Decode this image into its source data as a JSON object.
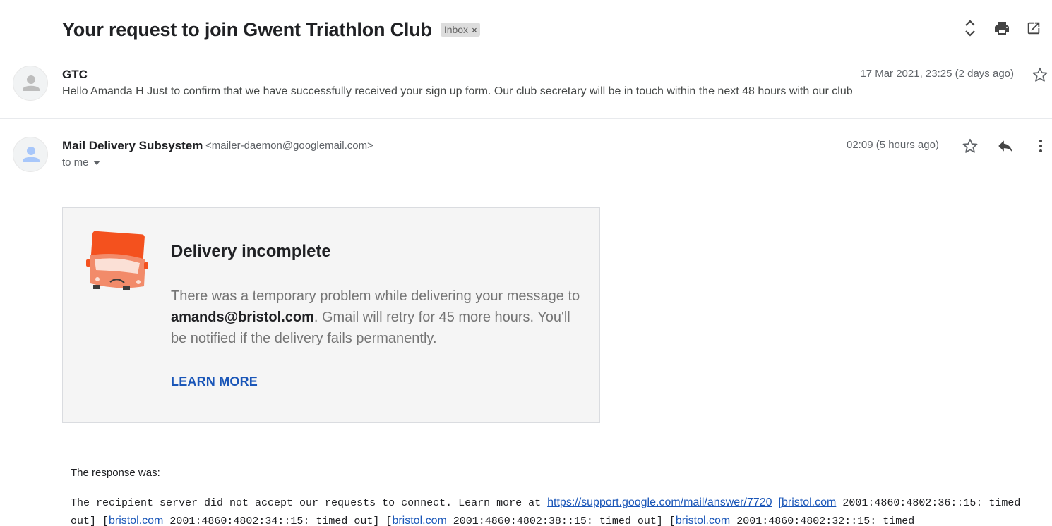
{
  "thread": {
    "subject": "Your request to join Gwent Triathlon Club",
    "label": "Inbox",
    "label_remove": "×"
  },
  "toolbar_icons": [
    "expand-collapse-icon",
    "print-icon",
    "open-new-window-icon"
  ],
  "messages": [
    {
      "sender": "GTC",
      "date": "17 Mar 2021, 23:25 (2 days ago)",
      "snippet": "Hello Amanda H Just to confirm that we have successfully received your sign up form. Our club secretary will be in touch within the next 48 hours with our club"
    },
    {
      "sender": "Mail Delivery Subsystem",
      "sender_email": "<mailer-daemon@googlemail.com>",
      "recipient": "to me",
      "date": "02:09 (5 hours ago)"
    }
  ],
  "bounce": {
    "title": "Delivery incomplete",
    "text_before": "There was a temporary problem while delivering your message to ",
    "recipient": "amands@bristol.com",
    "text_after": ". Gmail will retry for 45 more hours. You'll be notified if the delivery fails permanently.",
    "learn_more": "LEARN MORE"
  },
  "response": {
    "label": "The response was:",
    "t1": "The recipient server did not accept our requests to connect. Learn more at ",
    "link1": "https://support.google.com/mail/answer/7720",
    "t2": " ",
    "link2": "[bristol.com",
    "t3": " 2001:4860:4802:36::15: timed out] [",
    "link3": "bristol.com",
    "t4": " 2001:4860:4802:34::15: timed out] [",
    "link4": "bristol.com",
    "t5": " 2001:4860:4802:38::15: timed out] [",
    "link5": "bristol.com",
    "t6": " 2001:4860:4802:32::15: timed"
  },
  "colors": {
    "link": "#1a56b8",
    "truck_body": "#f4511e",
    "truck_front": "#f28b6a",
    "card_bg": "#f5f5f5",
    "label_chip": "#dddddd"
  }
}
